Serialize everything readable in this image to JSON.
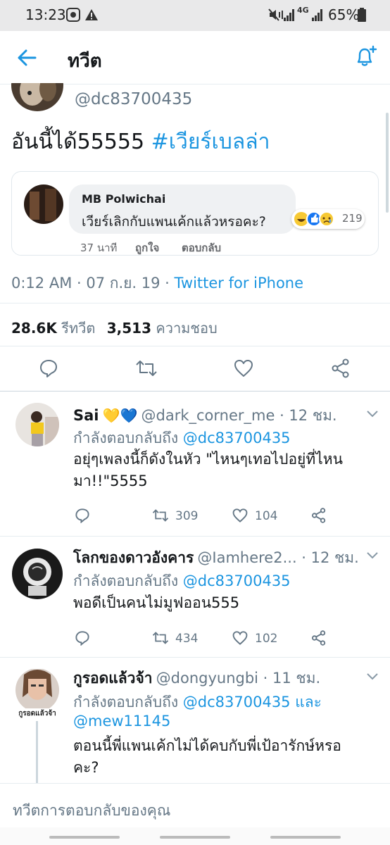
{
  "status_bar": {
    "time": "13:23",
    "battery": "65%",
    "network": "4G"
  },
  "header": {
    "title": "ทวีต"
  },
  "main_tweet": {
    "handle": "@dc83700435",
    "text": "อันนี้ได้55555",
    "hashtag": "#เวียร์เบลล่า",
    "meta_time": "0:12 AM · 07 ก.ย. 19 · ",
    "meta_source": "Twitter for iPhone",
    "retweets_count": "28.6K",
    "retweets_label": "รีทวีต",
    "likes_count": "3,513",
    "likes_label": "ความชอบ"
  },
  "quoted_comment": {
    "name": "MB Polwichai",
    "text": "เวียร์เลิกกับแพนเค้กแล้วหรอคะ?",
    "reaction_count": "219",
    "time": "37 นาที",
    "like_label": "ถูกใจ",
    "reply_label": "ตอบกลับ"
  },
  "replies": [
    {
      "name": "Sai",
      "hearts": "💛💙",
      "handle": "@dark_corner_me · 12 ชม.",
      "replying_prefix": "กำลังตอบกลับถึง ",
      "replying_to": "@dc83700435",
      "text_line1": "อยุ่ๆเพลงนี้ก็ดังในหัว  \"ไหนๆเทอไปอยู่ที่ไหน",
      "text_line2": "มา!!\"5555",
      "retweets": "309",
      "likes": "104"
    },
    {
      "name": "โลกของดาวอังคาร",
      "handle": "@Iamhere2... · 12 ชม.",
      "replying_prefix": "กำลังตอบกลับถึง ",
      "replying_to": "@dc83700435",
      "text_line1": "พอดีเป็นคนไม่มูฟออน555",
      "retweets": "434",
      "likes": "102"
    },
    {
      "name": "กูรอดแล้วจ้า",
      "handle": "@dongyungbi · 11 ชม.",
      "replying_prefix": "กำลังตอบกลับถึง ",
      "replying_to": "@dc83700435",
      "replying_and": " และ",
      "replying_to2": "@mew11145",
      "avatar_caption": "กูรอดแล้วจ้า",
      "text_line1": "ตอนนี้พี่แพนเค้กไม่ได้คบกับพี่เป้อารักษ์หรอ",
      "text_line2": "คะ?"
    }
  ],
  "compose": {
    "placeholder": "ทวีตการตอบกลับของคุณ"
  },
  "colors": {
    "accent": "#1b95e0",
    "text": "#14171a",
    "secondary": "#657786"
  }
}
